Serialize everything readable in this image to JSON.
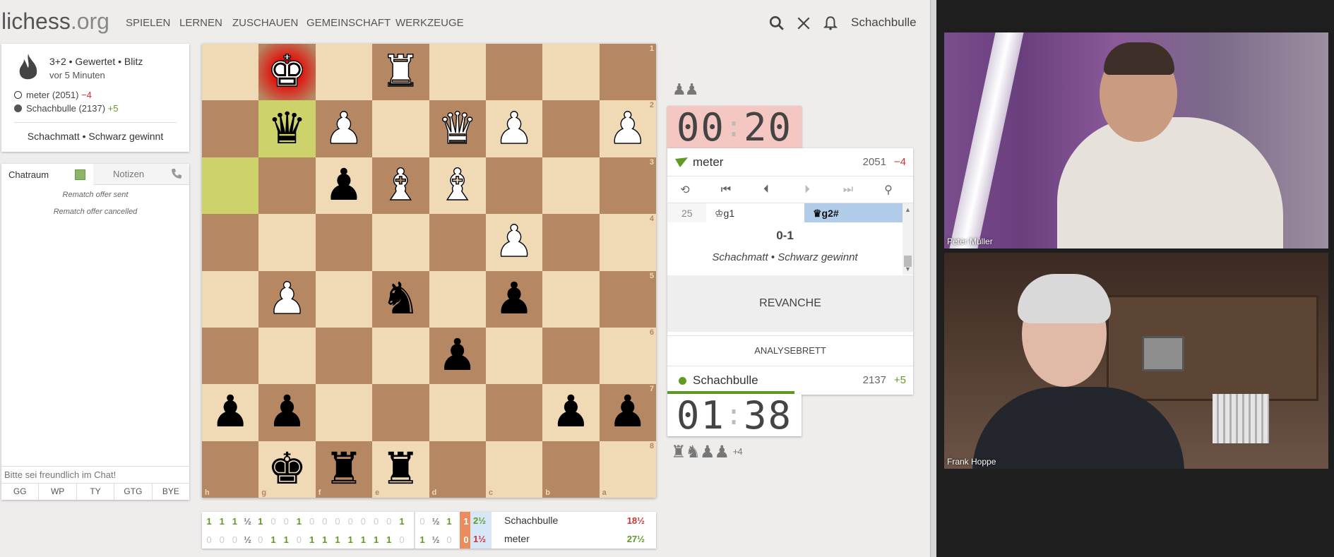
{
  "nav": {
    "logo_main": "lichess",
    "logo_tld": ".org",
    "items": [
      "SPIELEN",
      "LERNEN",
      "ZUSCHAUEN",
      "GEMEINSCHAFT",
      "WERKZEUGE"
    ],
    "username": "Schachbulle"
  },
  "game_info": {
    "setup": "3+2 • Gewertet • Blitz",
    "time_ago": "vor 5 Minuten",
    "white_player": "meter (2051)",
    "white_diff": "−4",
    "black_player": "Schachbulle (2137)",
    "black_diff": "+5",
    "result": "Schachmatt • Schwarz gewinnt"
  },
  "chat": {
    "tab_chat": "Chatraum",
    "tab_notes": "Notizen",
    "messages": [
      "Rematch offer sent",
      "Rematch offer cancelled"
    ],
    "placeholder": "Bitte sei freundlich im Chat!",
    "presets": [
      "GG",
      "WP",
      "TY",
      "GTG",
      "BYE"
    ]
  },
  "board": {
    "ranks_labels": [
      "1",
      "2",
      "3",
      "4",
      "5",
      "6",
      "7",
      "8"
    ],
    "files_labels": [
      "h",
      "g",
      "f",
      "e",
      "d",
      "c",
      "b",
      "a"
    ],
    "rows": [
      [
        "",
        "wK",
        "",
        "wR",
        "",
        "",
        "",
        ""
      ],
      [
        "",
        "bQ",
        "wP",
        "",
        "wQ",
        "wP",
        "",
        "wP"
      ],
      [
        "",
        "",
        "bP",
        "wB",
        "wB",
        "",
        "",
        ""
      ],
      [
        "",
        "",
        "",
        "",
        "",
        "wP",
        "",
        ""
      ],
      [
        "",
        "wP",
        "",
        "bN",
        "",
        "bP",
        "",
        ""
      ],
      [
        "",
        "",
        "",
        "",
        "bP",
        "",
        "",
        ""
      ],
      [
        "bP",
        "bP",
        "",
        "",
        "",
        "",
        "bP",
        "bP"
      ],
      [
        "",
        "bK",
        "bR",
        "bR",
        "",
        "",
        "",
        ""
      ]
    ]
  },
  "opponent": {
    "captured": "♟♟",
    "clock_min": "00",
    "clock_sec": "20",
    "name": "meter",
    "rating": "2051",
    "diff": "−4"
  },
  "moves": {
    "number": "25",
    "white": "♔g1",
    "black": "♛g2#",
    "result": "0-1",
    "status": "Schachmatt • Schwarz gewinnt"
  },
  "buttons": {
    "rematch": "REVANCHE",
    "analysis": "ANALYSEBRETT"
  },
  "me": {
    "name": "Schachbulle",
    "rating": "2137",
    "diff": "+5",
    "clock_min": "01",
    "clock_sec": "38",
    "captured": "♜♞♟♟",
    "captured_plus": "+4"
  },
  "crosstable": {
    "row1": [
      "1",
      "1",
      "1",
      "½",
      "1",
      "0",
      "0",
      "1",
      "0",
      "0",
      "0",
      "0",
      "0",
      "0",
      "0",
      "1"
    ],
    "row2": [
      "0",
      "0",
      "0",
      "½",
      "0",
      "1",
      "1",
      "0",
      "1",
      "1",
      "1",
      "1",
      "1",
      "1",
      "1",
      "0"
    ],
    "cur1": [
      "0",
      "½",
      "1",
      "1"
    ],
    "cur2": [
      "1",
      "½",
      "0",
      "0"
    ],
    "sub1": "2½",
    "sub2": "1½",
    "name1": "Schachbulle",
    "name2": "meter",
    "total1": "18½",
    "total2": "27½"
  },
  "videos": {
    "top_name": "Peter Müller",
    "bottom_name": "Frank Hoppe"
  },
  "colors": {
    "accent_green": "#629924",
    "loss_red": "#c33",
    "clock_low_bg": "#f4c7c3"
  }
}
